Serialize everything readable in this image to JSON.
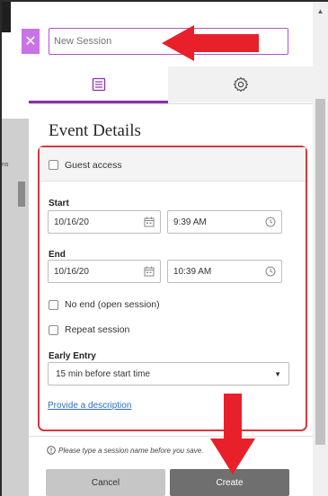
{
  "session_name": {
    "placeholder": "New Session"
  },
  "close_symbol": "✕",
  "tabs": {
    "details_icon": "list-icon",
    "settings_icon": "gear-icon"
  },
  "section_title": "Event Details",
  "guest_access": {
    "label": "Guest access"
  },
  "start": {
    "label": "Start",
    "date": "10/16/20",
    "time": "9:39 AM"
  },
  "end": {
    "label": "End",
    "date": "10/16/20",
    "time": "10:39 AM"
  },
  "options": {
    "no_end": "No end (open session)",
    "repeat": "Repeat session"
  },
  "early_entry": {
    "label": "Early Entry",
    "value": "15 min before start time"
  },
  "description_link": "Provide a description",
  "footer": {
    "warning": "Please type a session name before you save.",
    "cancel": "Cancel",
    "create": "Create"
  },
  "colors": {
    "accent": "#8e2db2",
    "highlight": "#d9363e",
    "create_button": "#6f6f6f"
  }
}
